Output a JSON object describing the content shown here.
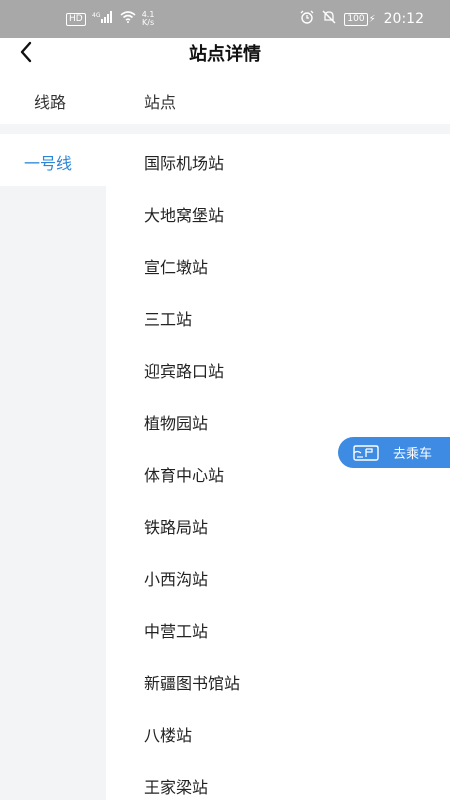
{
  "status_bar": {
    "hd": "HD",
    "network": "4G",
    "net_speed_value": "4.1",
    "net_speed_unit": "K/s",
    "battery": "100",
    "time": "20:12"
  },
  "header": {
    "title": "站点详情"
  },
  "columns": {
    "line": "线路",
    "station": "站点"
  },
  "lines": [
    {
      "label": "一号线",
      "selected": true
    }
  ],
  "stations": [
    "国际机场站",
    "大地窝堡站",
    "宣仁墩站",
    "三工站",
    "迎宾路口站",
    "植物园站",
    "体育中心站",
    "铁路局站",
    "小西沟站",
    "中营工站",
    "新疆图书馆站",
    "八楼站",
    "王家梁站"
  ],
  "ride_button": {
    "label": "去乘车",
    "icon": "ticket-icon"
  },
  "colors": {
    "accent": "#2a86d8",
    "button": "#3d8be3",
    "status_bar": "#a8a8a8"
  }
}
